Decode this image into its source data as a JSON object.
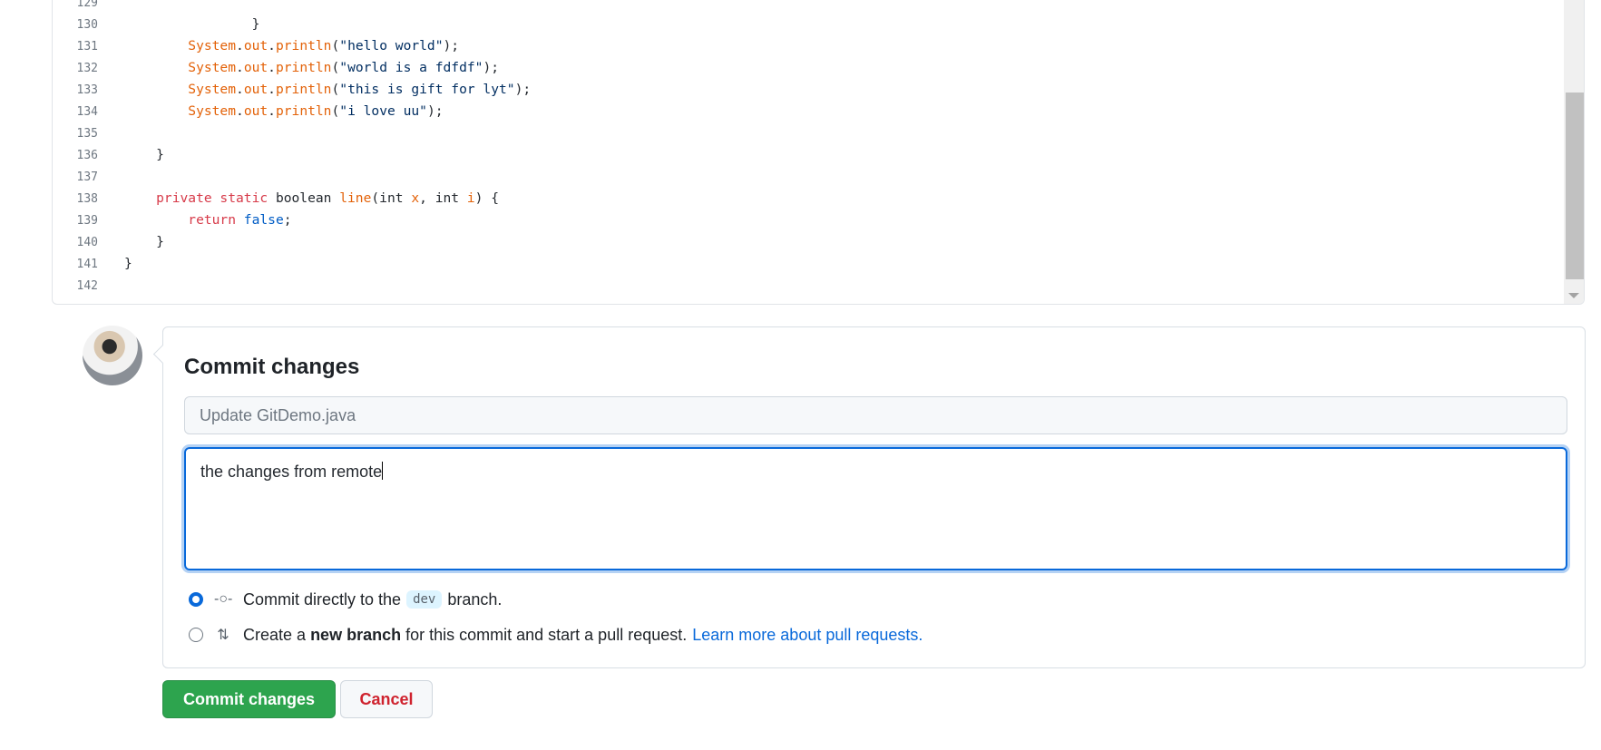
{
  "code": {
    "lines": [
      {
        "n": "129",
        "tokens": []
      },
      {
        "n": "130",
        "tokens": [
          {
            "t": "                }",
            "c": "plain"
          }
        ]
      },
      {
        "n": "131",
        "tokens": [
          {
            "t": "        System",
            "c": "sys"
          },
          {
            "t": ".",
            "c": "plain"
          },
          {
            "t": "out",
            "c": "sys"
          },
          {
            "t": ".",
            "c": "plain"
          },
          {
            "t": "println",
            "c": "sys"
          },
          {
            "t": "(",
            "c": "plain"
          },
          {
            "t": "\"hello world\"",
            "c": "str"
          },
          {
            "t": ");",
            "c": "plain"
          }
        ]
      },
      {
        "n": "132",
        "tokens": [
          {
            "t": "        System",
            "c": "sys"
          },
          {
            "t": ".",
            "c": "plain"
          },
          {
            "t": "out",
            "c": "sys"
          },
          {
            "t": ".",
            "c": "plain"
          },
          {
            "t": "println",
            "c": "sys"
          },
          {
            "t": "(",
            "c": "plain"
          },
          {
            "t": "\"world is a fdfdf\"",
            "c": "str"
          },
          {
            "t": ");",
            "c": "plain"
          }
        ]
      },
      {
        "n": "133",
        "tokens": [
          {
            "t": "        System",
            "c": "sys"
          },
          {
            "t": ".",
            "c": "plain"
          },
          {
            "t": "out",
            "c": "sys"
          },
          {
            "t": ".",
            "c": "plain"
          },
          {
            "t": "println",
            "c": "sys"
          },
          {
            "t": "(",
            "c": "plain"
          },
          {
            "t": "\"this is gift for lyt\"",
            "c": "str"
          },
          {
            "t": ");",
            "c": "plain"
          }
        ]
      },
      {
        "n": "134",
        "tokens": [
          {
            "t": "        System",
            "c": "sys"
          },
          {
            "t": ".",
            "c": "plain"
          },
          {
            "t": "out",
            "c": "sys"
          },
          {
            "t": ".",
            "c": "plain"
          },
          {
            "t": "println",
            "c": "sys"
          },
          {
            "t": "(",
            "c": "plain"
          },
          {
            "t": "\"i love uu\"",
            "c": "str"
          },
          {
            "t": ");",
            "c": "plain"
          }
        ]
      },
      {
        "n": "135",
        "tokens": []
      },
      {
        "n": "136",
        "tokens": [
          {
            "t": "    }",
            "c": "plain"
          }
        ]
      },
      {
        "n": "137",
        "tokens": []
      },
      {
        "n": "138",
        "tokens": [
          {
            "t": "    private static ",
            "c": "kw"
          },
          {
            "t": "boolean ",
            "c": "plain"
          },
          {
            "t": "line",
            "c": "fn"
          },
          {
            "t": "(int ",
            "c": "plain"
          },
          {
            "t": "x",
            "c": "param"
          },
          {
            "t": ", int ",
            "c": "plain"
          },
          {
            "t": "i",
            "c": "param"
          },
          {
            "t": ") {",
            "c": "plain"
          }
        ]
      },
      {
        "n": "139",
        "tokens": [
          {
            "t": "        return ",
            "c": "kw"
          },
          {
            "t": "false",
            "c": "const"
          },
          {
            "t": ";",
            "c": "plain"
          }
        ]
      },
      {
        "n": "140",
        "tokens": [
          {
            "t": "    }",
            "c": "plain"
          }
        ]
      },
      {
        "n": "141",
        "tokens": [
          {
            "t": "}",
            "c": "plain"
          }
        ]
      },
      {
        "n": "142",
        "tokens": []
      }
    ]
  },
  "commit": {
    "title": "Commit changes",
    "summary_placeholder": "Update GitDemo.java",
    "description_value": "the changes from remote",
    "option_direct": {
      "before": "Commit directly to the",
      "branch": "dev",
      "after": "branch.",
      "selected": true
    },
    "option_new": {
      "before": "Create a",
      "bold": "new branch",
      "after": "for this commit and start a pull request.",
      "link": "Learn more about pull requests.",
      "selected": false
    },
    "commit_button": "Commit changes",
    "cancel_button": "Cancel"
  },
  "icons": {
    "commit": "git-commit-icon",
    "pr": "git-pull-request-icon"
  },
  "colors": {
    "accent": "#0969da",
    "primary_button": "#2da44e",
    "danger": "#cf222e"
  }
}
